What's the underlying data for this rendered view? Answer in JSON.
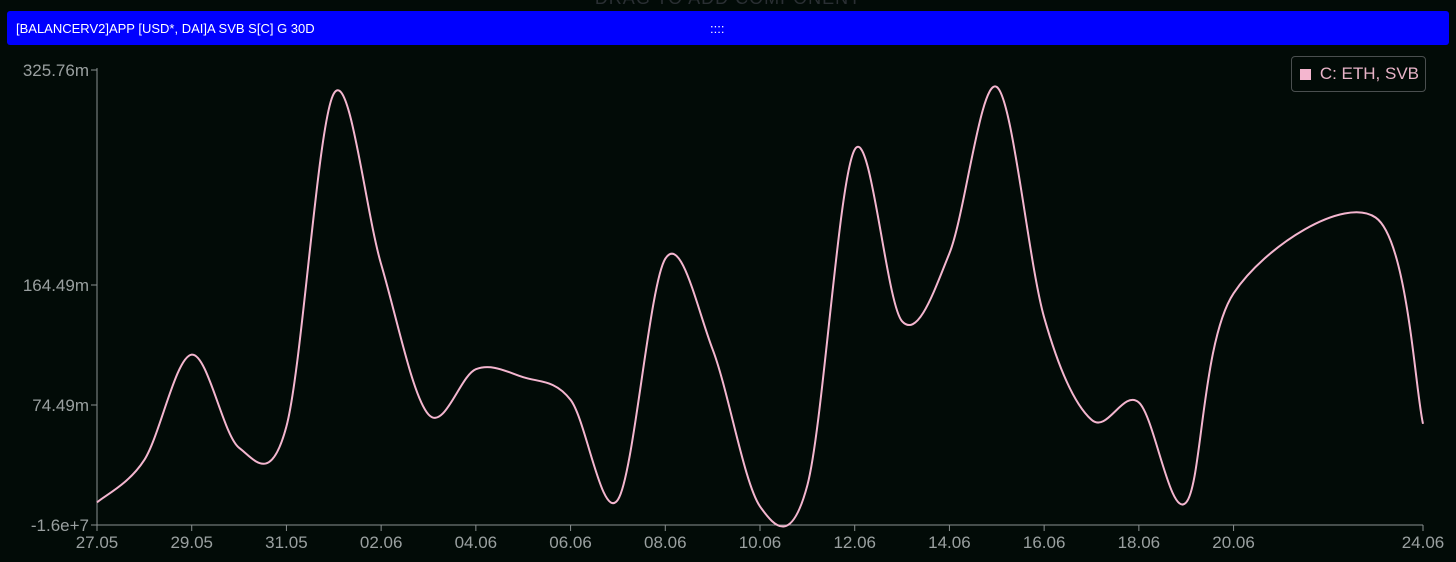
{
  "header": {
    "drag_hint": "DRAG TO ADD COMPONENT",
    "title": "[BALANCERV2]APP [USD*, DAI]A SVB S[C] G 30D",
    "drag_handle": "::::"
  },
  "colors": {
    "background": "#020b07",
    "header_bg": "#0000ff",
    "series": "#f4b6cf",
    "axis": "#8a9090"
  },
  "legend": {
    "label": "C: ETH, SVB"
  },
  "chart_data": {
    "type": "line",
    "title": "",
    "xlabel": "",
    "ylabel": "",
    "x_ticks": [
      "27.05",
      "29.05",
      "31.05",
      "02.06",
      "04.06",
      "06.06",
      "08.06",
      "10.06",
      "12.06",
      "14.06",
      "16.06",
      "18.06",
      "20.06",
      "24.06"
    ],
    "y_ticks": [
      "325.76m",
      "164.49m",
      "74.49m",
      "-1.6e+7"
    ],
    "ylim": [
      -16000000,
      325760000
    ],
    "xlim": [
      "2024-05-27",
      "2024-06-24"
    ],
    "grid": false,
    "legend_position": "top-right",
    "series": [
      {
        "name": "C: ETH, SVB",
        "x": [
          "2024-05-27",
          "2024-05-28",
          "2024-05-29",
          "2024-05-30",
          "2024-05-31",
          "2024-06-01",
          "2024-06-02",
          "2024-06-03",
          "2024-06-04",
          "2024-06-05",
          "2024-06-06",
          "2024-06-07",
          "2024-06-08",
          "2024-06-09",
          "2024-06-10",
          "2024-06-11",
          "2024-06-12",
          "2024-06-13",
          "2024-06-14",
          "2024-06-15",
          "2024-06-16",
          "2024-06-17",
          "2024-06-18",
          "2024-06-19",
          "2024-06-20",
          "2024-06-23",
          "2024-06-24"
        ],
        "values": [
          1000000,
          33000000,
          112000000,
          42000000,
          58000000,
          308000000,
          180000000,
          67000000,
          101000000,
          95000000,
          78000000,
          3000000,
          184000000,
          116000000,
          -2000000,
          14000000,
          266000000,
          137000000,
          188000000,
          313000000,
          140000000,
          63000000,
          76000000,
          1000000,
          158000000,
          215000000,
          60000000
        ]
      }
    ]
  }
}
